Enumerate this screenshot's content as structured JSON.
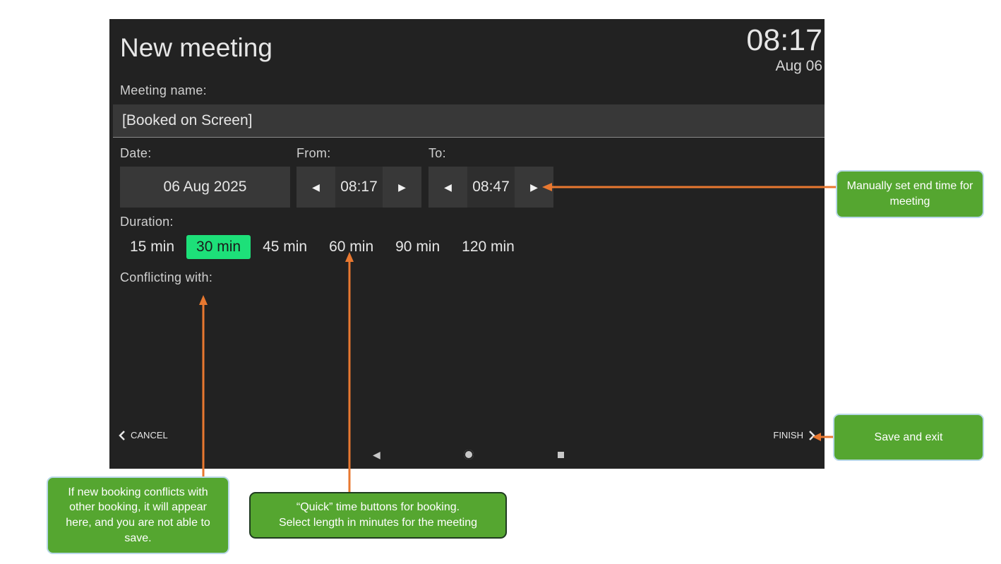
{
  "header": {
    "title": "New meeting",
    "clock_time": "08:17",
    "clock_date": "Aug 06"
  },
  "form": {
    "meeting_name_label": "Meeting name:",
    "meeting_name_value": "[Booked on Screen]",
    "date_label": "Date:",
    "date_value": "06 Aug 2025",
    "from_label": "From:",
    "from_value": "08:17",
    "to_label": "To:",
    "to_value": "08:47",
    "duration_label": "Duration:",
    "durations": [
      "15 min",
      "30 min",
      "45 min",
      "60 min",
      "90 min",
      "120 min"
    ],
    "selected_duration": "30 min",
    "conflicting_label": "Conflicting with:"
  },
  "footer": {
    "cancel_label": "CANCEL",
    "finish_label": "FINISH"
  },
  "callouts": {
    "end_time": "Manually set end time for meeting",
    "save_exit": "Save and exit",
    "conflicts": "If new booking conflicts with other booking, it will appear here, and you are not able to save.",
    "quick_line1": "“Quick” time buttons for booking.",
    "quick_line2": "Select length in minutes for the meeting"
  },
  "colors": {
    "screen_bg": "#222222",
    "selected_accent": "#1de079",
    "callout_bg": "#55a630",
    "arrow": "#e87830"
  }
}
